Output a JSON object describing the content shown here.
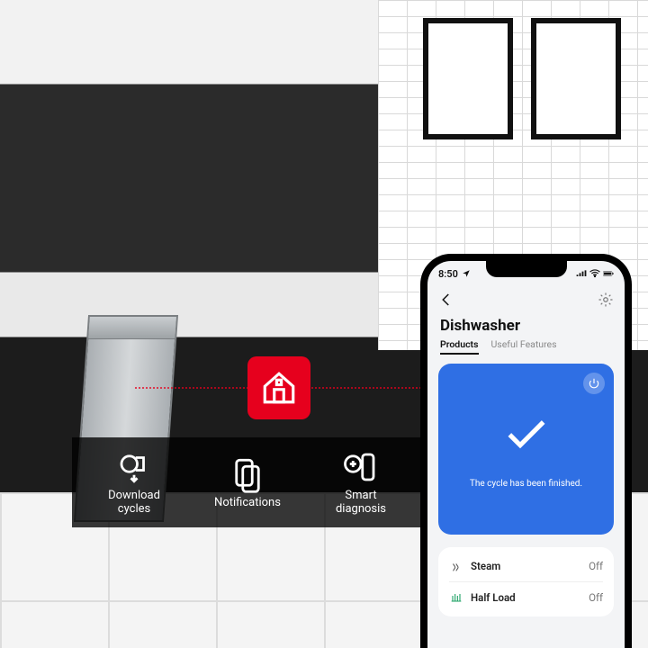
{
  "app_icon": {
    "name": "thinq-home-icon"
  },
  "features": [
    {
      "icon": "download-cycles-icon",
      "label": "Download\ncycles"
    },
    {
      "icon": "notifications-icon",
      "label": "Notifications"
    },
    {
      "icon": "smart-diagnosis-icon",
      "label": "Smart\ndiagnosis"
    }
  ],
  "phone": {
    "status": {
      "time": "8:50"
    },
    "title": "Dishwasher",
    "tabs": [
      {
        "label": "Products",
        "active": true
      },
      {
        "label": "Useful Features",
        "active": false
      }
    ],
    "card": {
      "message": "The cycle has been finished."
    },
    "options": [
      {
        "icon": "steam-icon",
        "name": "Steam",
        "value": "Off"
      },
      {
        "icon": "half-load-icon",
        "name": "Half Load",
        "value": "Off"
      }
    ]
  }
}
